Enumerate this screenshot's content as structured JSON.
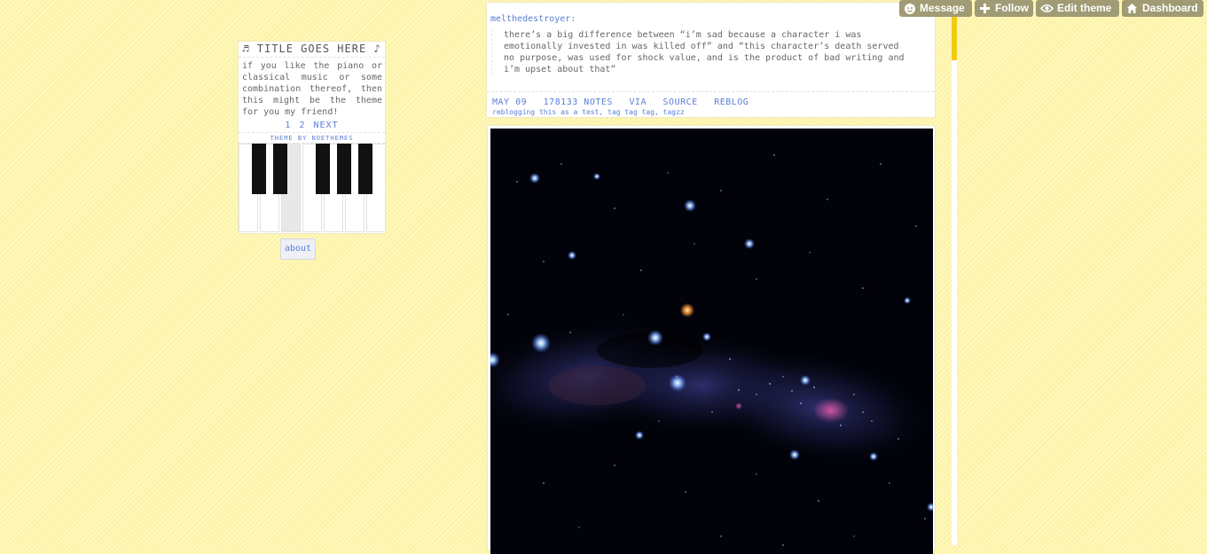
{
  "sidebar": {
    "title": "♬ TITLE GOES HERE ♪",
    "description": "if you like the piano or classical music or some combination thereof, then this might be the theme for you my friend!",
    "pagination": [
      "1",
      "2",
      "NEXT"
    ],
    "credit": "THEME BY NOETHEMES",
    "about_label": "about"
  },
  "text_post": {
    "username": "melthedestroyer:",
    "quote": "there’s a big difference between “i’m sad because a character i was emotionally invested in was killed off” and “this character’s death served no purpose, was used for shock value, and is the product of bad writing and i’m upset about that”",
    "date": "MAY 09",
    "notes": "178133 NOTES",
    "via": "VIA",
    "source": "SOURCE",
    "reblog": "REBLOG",
    "tags": "reblogging this as a test, tag tag tag, tagzz"
  },
  "photo_post": {
    "image": "starry-night-sky-photo"
  },
  "controls": {
    "message": "Message",
    "follow": "Follow",
    "edit_theme": "Edit theme",
    "dashboard": "Dashboard"
  },
  "colors": {
    "background": "#fdf3a6",
    "link": "#5b7ed6",
    "control_bg": "#a09b74",
    "scroll_thumb": "#f2cb10"
  }
}
